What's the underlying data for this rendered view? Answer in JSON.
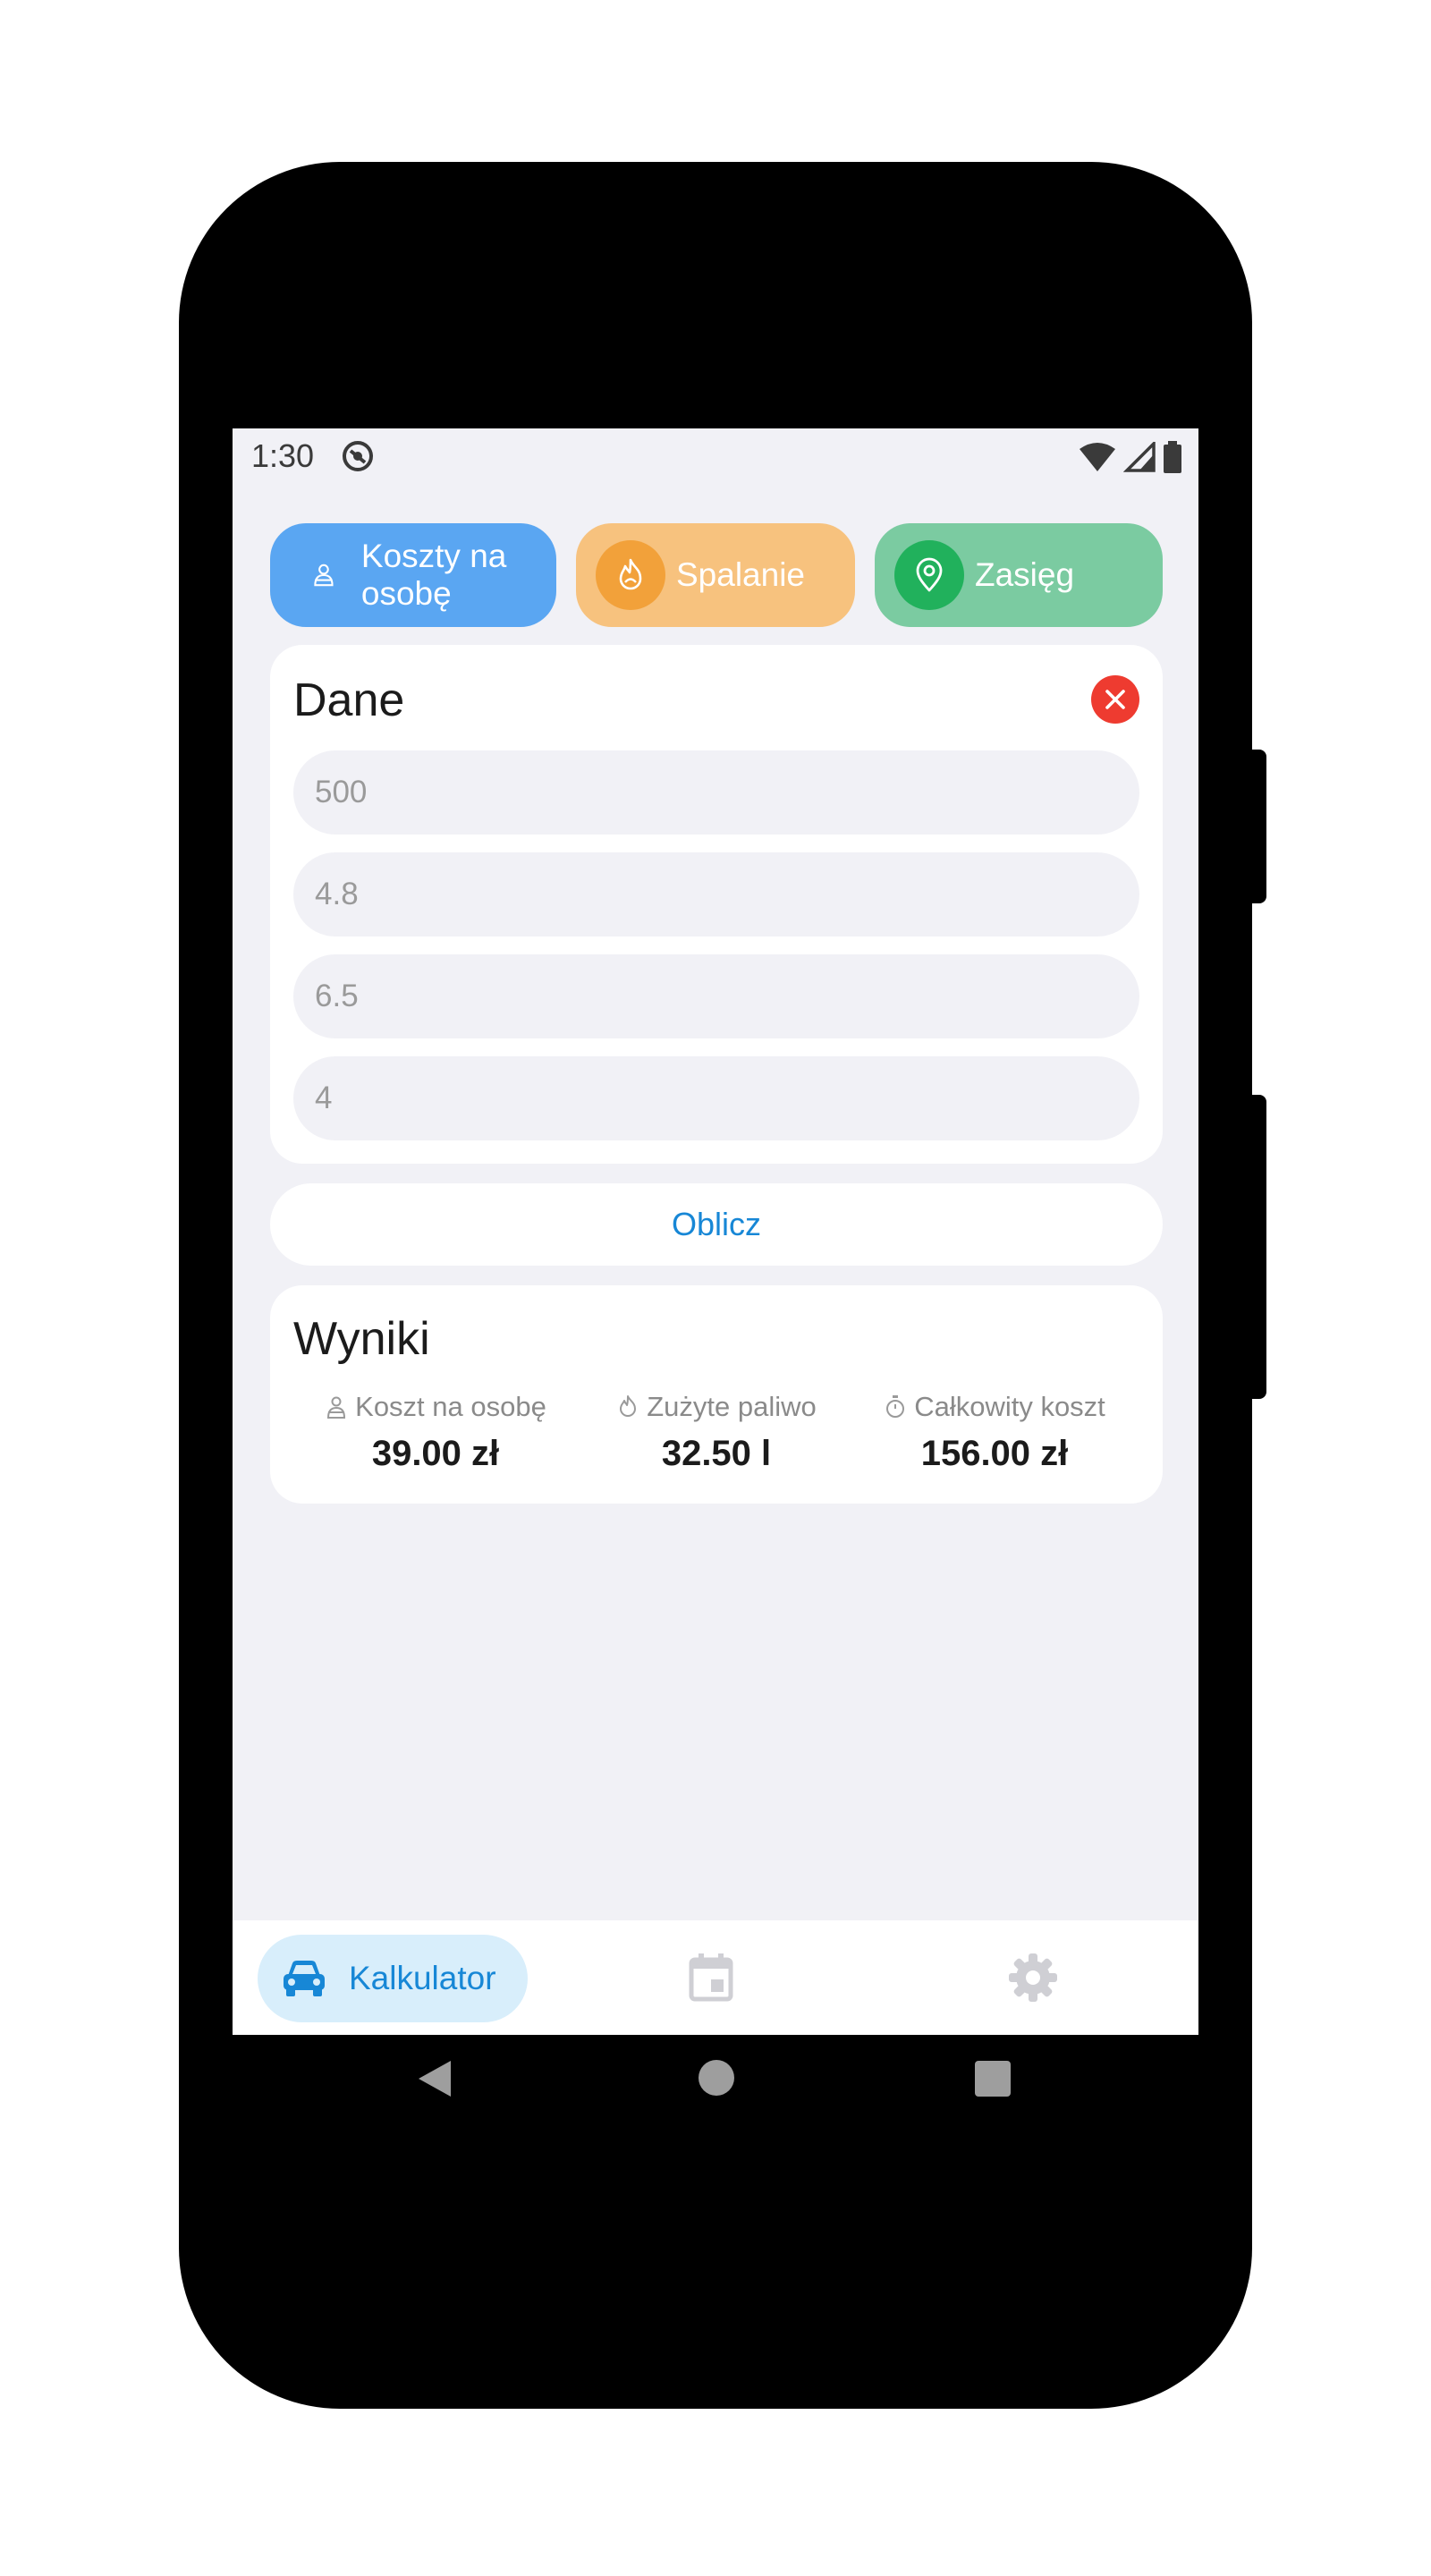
{
  "status_bar": {
    "time": "1:30"
  },
  "mode_chips": [
    {
      "label": "Koszty na osobę",
      "icon": "person-icon",
      "color": "#5aa6f2"
    },
    {
      "label": "Spalanie",
      "icon": "flame-icon",
      "color": "#f7c27e"
    },
    {
      "label": "Zasięg",
      "icon": "map-pin-icon",
      "color": "#7bcba1"
    }
  ],
  "data_card": {
    "title": "Dane",
    "fields": [
      {
        "placeholder": "500",
        "value": ""
      },
      {
        "placeholder": "4.8",
        "value": ""
      },
      {
        "placeholder": "6.5",
        "value": ""
      },
      {
        "placeholder": "4",
        "value": ""
      }
    ]
  },
  "calculate_button": {
    "label": "Oblicz"
  },
  "results_card": {
    "title": "Wyniki",
    "items": [
      {
        "label": "Koszt na osobę",
        "value": "39.00 zł",
        "icon": "person-icon"
      },
      {
        "label": "Zużyte paliwo",
        "value": "32.50 l",
        "icon": "flame-icon"
      },
      {
        "label": "Całkowity koszt",
        "value": "156.00 zł",
        "icon": "timer-icon"
      }
    ]
  },
  "bottom_nav": {
    "items": [
      {
        "label": "Kalkulator",
        "icon": "car-icon",
        "active": true
      },
      {
        "label": "",
        "icon": "calendar-icon",
        "active": false
      },
      {
        "label": "",
        "icon": "gear-icon",
        "active": false
      }
    ]
  },
  "colors": {
    "accent": "#1787d6",
    "danger": "#ee3b30",
    "screen_bg": "#f1f1f6"
  }
}
